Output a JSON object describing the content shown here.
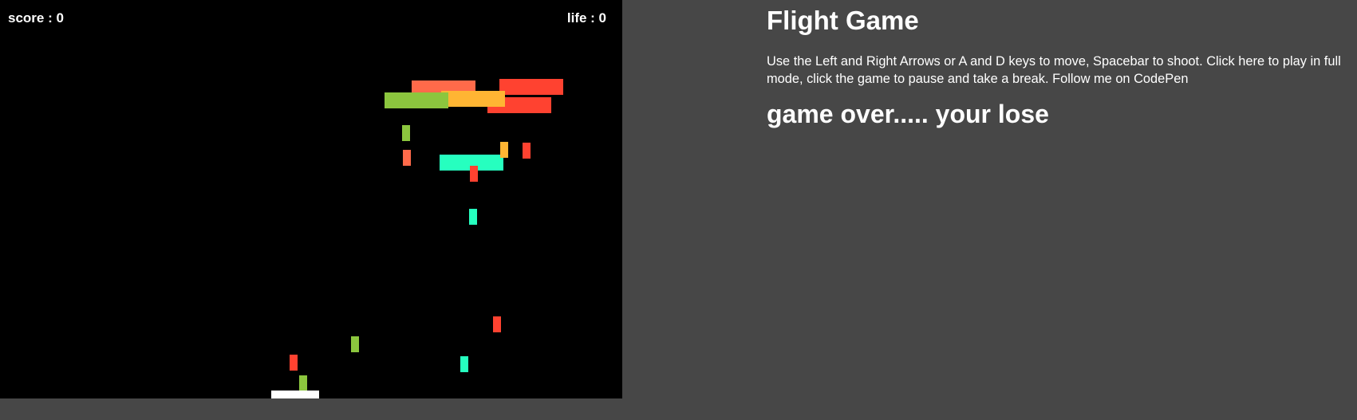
{
  "hud": {
    "score_label": "score : 0",
    "life_label": "life : 0"
  },
  "info": {
    "title": "Flight Game",
    "instructions": "Use the Left and Right Arrows or A and D keys to move, Spacebar to shoot. Click here to play in full mode, click the game to pause and take a break. Follow me on CodePen",
    "status": "game over..... your lose"
  },
  "colors": {
    "page_background": "#474747",
    "game_background": "#000000",
    "text": "#ffffff",
    "coral": "#ff6a4a",
    "red": "#ff4230",
    "orange": "#ffb533",
    "green": "#8cc63e",
    "mint": "#26ffbf",
    "player": "#ffffff"
  }
}
